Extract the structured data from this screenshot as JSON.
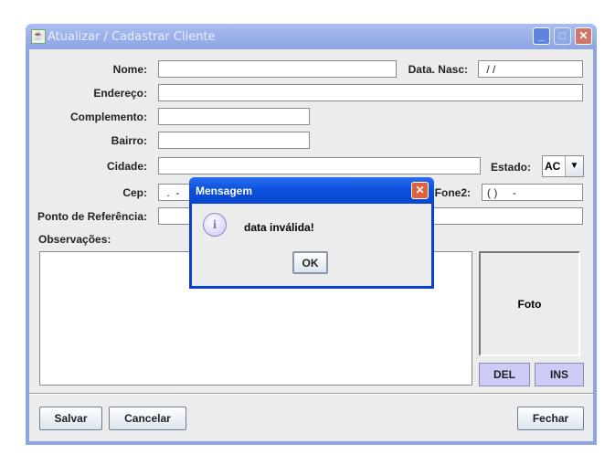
{
  "window": {
    "title": "Atualizar / Cadastrar Cliente"
  },
  "form": {
    "nome": {
      "label": "Nome:",
      "value": ""
    },
    "data_nasc": {
      "label": "Data. Nasc:",
      "value": " / /"
    },
    "endereco": {
      "label": "Endereço:",
      "value": ""
    },
    "complemento": {
      "label": "Complemento:",
      "value": ""
    },
    "bairro": {
      "label": "Bairro:",
      "value": ""
    },
    "cidade": {
      "label": "Cidade:",
      "value": ""
    },
    "estado": {
      "label": "Estado:",
      "value": "AC"
    },
    "cep": {
      "label": "Cep:",
      "value": " .  -"
    },
    "fone2": {
      "label": "Fone2:",
      "value": "( )     -"
    },
    "ponto_referencia": {
      "label": "Ponto de Referência:",
      "value": ""
    },
    "observacoes": {
      "label": "Observações:",
      "value": ""
    }
  },
  "photo": {
    "label": "Foto",
    "del": "DEL",
    "ins": "INS"
  },
  "buttons": {
    "salvar": "Salvar",
    "cancelar": "Cancelar",
    "fechar": "Fechar"
  },
  "dialog": {
    "title": "Mensagem",
    "message": "data inválida!",
    "ok": "OK"
  }
}
